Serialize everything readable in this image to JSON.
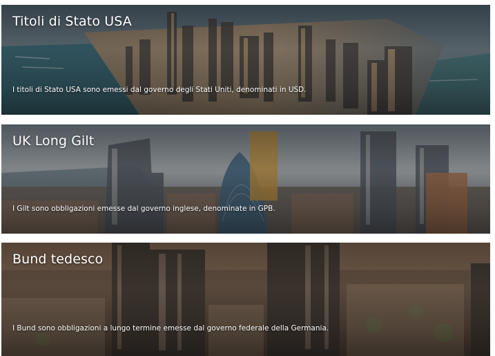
{
  "cards": [
    {
      "title": "Titoli di Stato USA",
      "description": "I titoli di Stato USA sono emessi dal governo degli Stati Uniti, denominati in USD."
    },
    {
      "title": "UK Long Gilt",
      "description": "I Gilt sono obbligazioni emesse dal governo inglese, denominate in GPB."
    },
    {
      "title": "Bund tedesco",
      "description": "I Bund sono obbligazioni a lungo termine emesse dal governo federale della Germania."
    }
  ]
}
